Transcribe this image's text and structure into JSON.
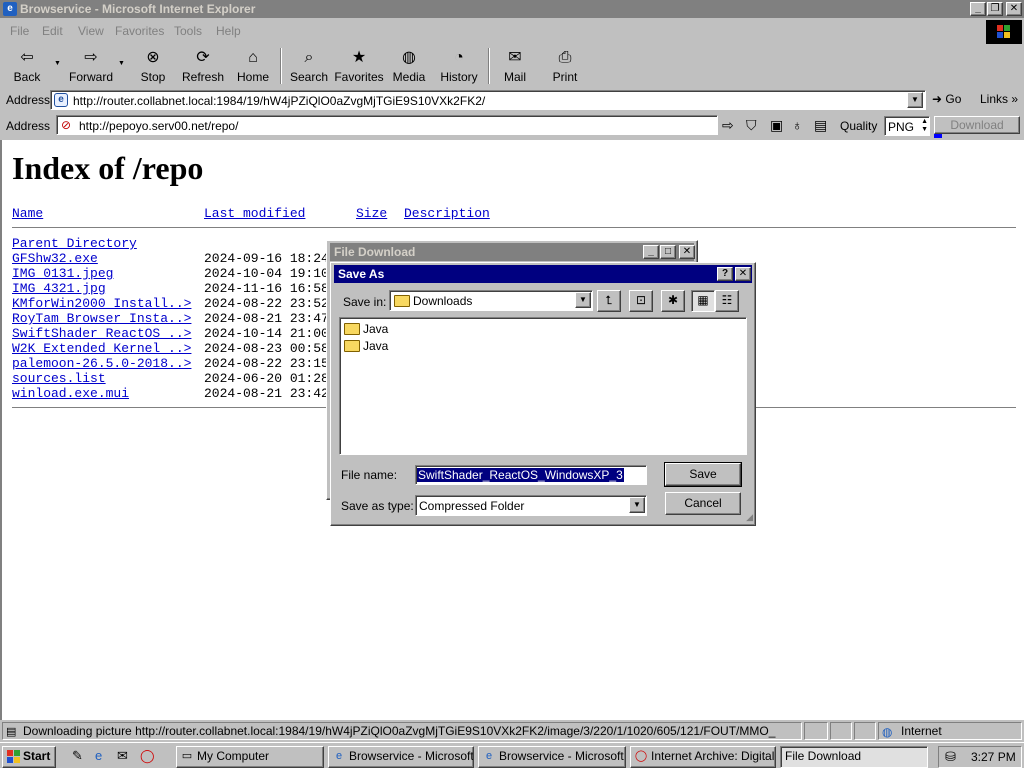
{
  "window": {
    "title": "Browservice - Microsoft Internet Explorer"
  },
  "menu": [
    "File",
    "Edit",
    "View",
    "Favorites",
    "Tools",
    "Help"
  ],
  "toolbar": {
    "back": "Back",
    "forward": "Forward",
    "stop": "Stop",
    "refresh": "Refresh",
    "home": "Home",
    "search": "Search",
    "favorites": "Favorites",
    "media": "Media",
    "history": "History",
    "mail": "Mail",
    "print": "Print"
  },
  "address": {
    "label": "Address",
    "url": "http://router.collabnet.local:1984/19/hW4jPZiQlO0aZvgMjTGiE9S10VXk2FK2/",
    "go": "Go",
    "links": "Links"
  },
  "inner_address": {
    "label": "Address",
    "url": "http://pepoyo.serv00.net/repo/",
    "quality_label": "Quality",
    "quality_value": "PNG",
    "download": "Download"
  },
  "page": {
    "title": "Index of /repo",
    "headers": {
      "name": "Name",
      "modified": "Last modified",
      "size": "Size",
      "description": "Description"
    },
    "parent": "Parent Directory",
    "rows": [
      {
        "name": "GFShw32.exe",
        "date": "2024-09-16 18:24"
      },
      {
        "name": "IMG_0131.jpeg",
        "date": "2024-10-04 19:10"
      },
      {
        "name": "IMG_4321.jpg",
        "date": "2024-11-16 16:58"
      },
      {
        "name": "KMforWin2000_Install..>",
        "date": "2024-08-22 23:52"
      },
      {
        "name": "RoyTam Browser Insta..>",
        "date": "2024-08-21 23:47"
      },
      {
        "name": "SwiftShader ReactOS_..>",
        "date": "2024-10-14 21:00"
      },
      {
        "name": "W2K Extended Kernel ..>",
        "date": "2024-08-23 00:58"
      },
      {
        "name": "palemoon-26.5.0-2018..>",
        "date": "2024-08-22 23:15"
      },
      {
        "name": "sources.list",
        "date": "2024-06-20 01:28"
      },
      {
        "name": "winload.exe.mui",
        "date": "2024-08-21 23:42"
      }
    ]
  },
  "file_download": {
    "title": "File Download"
  },
  "save_as": {
    "title": "Save As",
    "save_in_label": "Save in:",
    "save_in_value": "Downloads",
    "items": [
      "Java",
      "Java"
    ],
    "file_name_label": "File name:",
    "file_name_value": "SwiftShader_ReactOS_WindowsXP_3",
    "save_type_label": "Save as type:",
    "save_type_value": "Compressed Folder",
    "save_button": "Save",
    "cancel_button": "Cancel"
  },
  "status": {
    "text": "Downloading picture http://router.collabnet.local:1984/19/hW4jPZiQlO0aZvgMjTGiE9S10VXk2FK2/image/3/220/1/1020/605/121/FOUT/MMO_",
    "zone": "Internet"
  },
  "taskbar": {
    "start": "Start",
    "tasks": [
      "My Computer",
      "Browservice - Microsoft ...",
      "Browservice - Microsoft ...",
      "Internet Archive: Digital ...",
      "File Download"
    ],
    "clock": "3:27 PM"
  }
}
